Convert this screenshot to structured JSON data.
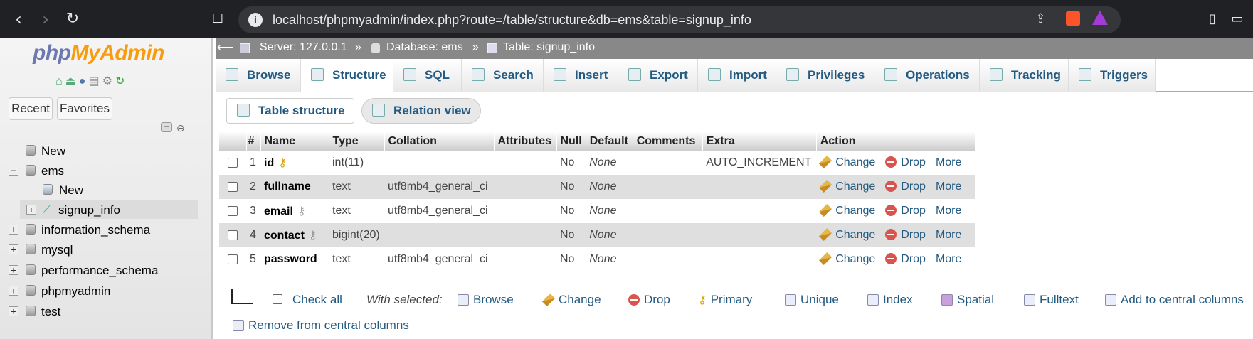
{
  "browser": {
    "url": "localhost/phpmyadmin/index.php?route=/table/structure&db=ems&table=signup_info"
  },
  "left": {
    "logo_part1": "php",
    "logo_part2": "MyAdmin",
    "recent": "Recent",
    "favorites": "Favorites",
    "tree": [
      {
        "label": "New"
      },
      {
        "label": "ems"
      },
      {
        "label": "New"
      },
      {
        "label": "signup_info"
      },
      {
        "label": "information_schema"
      },
      {
        "label": "mysql"
      },
      {
        "label": "performance_schema"
      },
      {
        "label": "phpmyadmin"
      },
      {
        "label": "test"
      }
    ]
  },
  "breadcrumb": {
    "server": "Server: 127.0.0.1",
    "database": "Database: ems",
    "table": "Table: signup_info",
    "sep": "»"
  },
  "tabs": [
    "Browse",
    "Structure",
    "SQL",
    "Search",
    "Insert",
    "Export",
    "Import",
    "Privileges",
    "Operations",
    "Tracking",
    "Triggers"
  ],
  "subtabs": {
    "structure": "Table structure",
    "relation": "Relation view"
  },
  "table": {
    "headers": [
      "#",
      "Name",
      "Type",
      "Collation",
      "Attributes",
      "Null",
      "Default",
      "Comments",
      "Extra",
      "Action"
    ],
    "rows": [
      {
        "num": "1",
        "name": "id",
        "type": "int(11)",
        "collation": "",
        "null": "No",
        "default": "None",
        "extra": "AUTO_INCREMENT"
      },
      {
        "num": "2",
        "name": "fullname",
        "type": "text",
        "collation": "utf8mb4_general_ci",
        "null": "No",
        "default": "None",
        "extra": ""
      },
      {
        "num": "3",
        "name": "email",
        "type": "text",
        "collation": "utf8mb4_general_ci",
        "null": "No",
        "default": "None",
        "extra": ""
      },
      {
        "num": "4",
        "name": "contact",
        "type": "bigint(20)",
        "collation": "",
        "null": "No",
        "default": "None",
        "extra": ""
      },
      {
        "num": "5",
        "name": "password",
        "type": "text",
        "collation": "utf8mb4_general_ci",
        "null": "No",
        "default": "None",
        "extra": ""
      }
    ],
    "actions": {
      "change": "Change",
      "drop": "Drop",
      "more": "More"
    }
  },
  "bottom": {
    "check_all": "Check all",
    "with_selected": "With selected:",
    "browse": "Browse",
    "change": "Change",
    "drop": "Drop",
    "primary": "Primary",
    "unique": "Unique",
    "index": "Index",
    "spatial": "Spatial",
    "fulltext": "Fulltext",
    "add_central": "Add to central columns",
    "remove_central": "Remove from central columns"
  }
}
